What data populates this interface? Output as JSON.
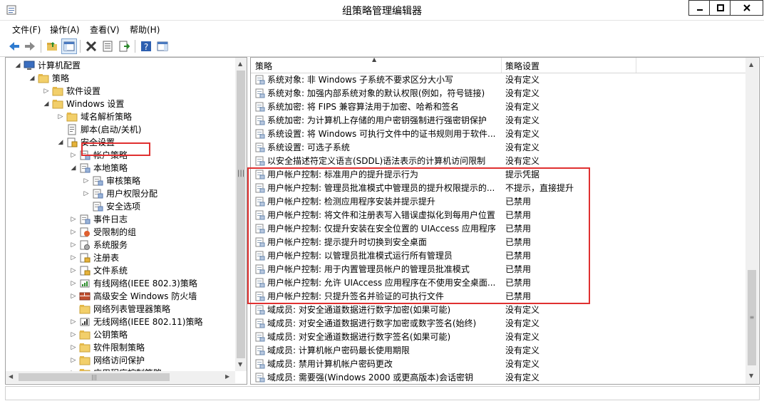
{
  "window": {
    "title": "组策略管理编辑器"
  },
  "menu": [
    "文件(F)",
    "操作(A)",
    "查看(V)",
    "帮助(H)"
  ],
  "tree": [
    {
      "label": "计算机配置",
      "indent": 0,
      "arrow": "◢",
      "icon": "computer"
    },
    {
      "label": "策略",
      "indent": 1,
      "arrow": "◢",
      "icon": "folder"
    },
    {
      "label": "软件设置",
      "indent": 2,
      "arrow": "▷",
      "icon": "folder"
    },
    {
      "label": "Windows 设置",
      "indent": 2,
      "arrow": "◢",
      "icon": "folder"
    },
    {
      "label": "域名解析策略",
      "indent": 3,
      "arrow": "▷",
      "icon": "folder"
    },
    {
      "label": "脚本(启动/关机)",
      "indent": 3,
      "arrow": "",
      "icon": "script"
    },
    {
      "label": "安全设置",
      "indent": 3,
      "arrow": "◢",
      "icon": "security"
    },
    {
      "label": "帐户策略",
      "indent": 4,
      "arrow": "▷",
      "icon": "policy"
    },
    {
      "label": "本地策略",
      "indent": 4,
      "arrow": "◢",
      "icon": "policy"
    },
    {
      "label": "审核策略",
      "indent": 5,
      "arrow": "▷",
      "icon": "policy"
    },
    {
      "label": "用户权限分配",
      "indent": 5,
      "arrow": "▷",
      "icon": "policy"
    },
    {
      "label": "安全选项",
      "indent": 5,
      "arrow": "",
      "icon": "policy"
    },
    {
      "label": "事件日志",
      "indent": 4,
      "arrow": "▷",
      "icon": "policy"
    },
    {
      "label": "受限制的组",
      "indent": 4,
      "arrow": "▷",
      "icon": "group"
    },
    {
      "label": "系统服务",
      "indent": 4,
      "arrow": "▷",
      "icon": "service"
    },
    {
      "label": "注册表",
      "indent": 4,
      "arrow": "▷",
      "icon": "registry"
    },
    {
      "label": "文件系统",
      "indent": 4,
      "arrow": "▷",
      "icon": "registry"
    },
    {
      "label": "有线网络(IEEE 802.3)策略",
      "indent": 4,
      "arrow": "▷",
      "icon": "wired"
    },
    {
      "label": "高级安全 Windows 防火墙",
      "indent": 4,
      "arrow": "▷",
      "icon": "firewall"
    },
    {
      "label": "网络列表管理器策略",
      "indent": 4,
      "arrow": "",
      "icon": "folder"
    },
    {
      "label": "无线网络(IEEE 802.11)策略",
      "indent": 4,
      "arrow": "▷",
      "icon": "wireless"
    },
    {
      "label": "公钥策略",
      "indent": 4,
      "arrow": "▷",
      "icon": "folder"
    },
    {
      "label": "软件限制策略",
      "indent": 4,
      "arrow": "▷",
      "icon": "folder"
    },
    {
      "label": "网络访问保护",
      "indent": 4,
      "arrow": "▷",
      "icon": "folder"
    },
    {
      "label": "应用程序控制策略",
      "indent": 4,
      "arrow": "▷",
      "icon": "folder"
    }
  ],
  "columns": {
    "policy": "策略",
    "setting": "策略设置"
  },
  "policies": [
    {
      "name": "系统对象: 非 Windows 子系统不要求区分大小写",
      "setting": "没有定义"
    },
    {
      "name": "系统对象: 加强内部系统对象的默认权限(例如，符号链接)",
      "setting": "没有定义"
    },
    {
      "name": "系统加密: 将 FIPS 兼容算法用于加密、哈希和签名",
      "setting": "没有定义"
    },
    {
      "name": "系统加密: 为计算机上存储的用户密钥强制进行强密钥保护",
      "setting": "没有定义"
    },
    {
      "name": "系统设置: 将 Windows 可执行文件中的证书规则用于软件...",
      "setting": "没有定义"
    },
    {
      "name": "系统设置: 可选子系统",
      "setting": "没有定义"
    },
    {
      "name": "以安全描述符定义语言(SDDL)语法表示的计算机访问限制",
      "setting": "没有定义"
    },
    {
      "name": "用户帐户控制: 标准用户的提升提示行为",
      "setting": "提示凭据"
    },
    {
      "name": "用户帐户控制: 管理员批准模式中管理员的提升权限提示的...",
      "setting": "不提示，直接提升"
    },
    {
      "name": "用户帐户控制: 检测应用程序安装并提示提升",
      "setting": "已禁用"
    },
    {
      "name": "用户帐户控制: 将文件和注册表写入错误虚拟化到每用户位置",
      "setting": "已禁用"
    },
    {
      "name": "用户帐户控制: 仅提升安装在安全位置的 UIAccess 应用程序",
      "setting": "已禁用"
    },
    {
      "name": "用户帐户控制: 提示提升时切换到安全桌面",
      "setting": "已禁用"
    },
    {
      "name": "用户帐户控制: 以管理员批准模式运行所有管理员",
      "setting": "已禁用"
    },
    {
      "name": "用户帐户控制: 用于内置管理员帐户的管理员批准模式",
      "setting": "已禁用"
    },
    {
      "name": "用户帐户控制: 允许 UIAccess 应用程序在不使用安全桌面...",
      "setting": "已禁用"
    },
    {
      "name": "用户帐户控制: 只提升签名并验证的可执行文件",
      "setting": "已禁用"
    },
    {
      "name": "域成员: 对安全通道数据进行数字加密(如果可能)",
      "setting": "没有定义"
    },
    {
      "name": "域成员: 对安全通道数据进行数字加密或数字签名(始终)",
      "setting": "没有定义"
    },
    {
      "name": "域成员: 对安全通道数据进行数字签名(如果可能)",
      "setting": "没有定义"
    },
    {
      "name": "域成员: 计算机帐户密码最长使用期限",
      "setting": "没有定义"
    },
    {
      "name": "域成员: 禁用计算机帐户密码更改",
      "setting": "没有定义"
    },
    {
      "name": "域成员: 需要强(Windows 2000 或更高版本)会话密钥",
      "setting": "没有定义"
    }
  ]
}
